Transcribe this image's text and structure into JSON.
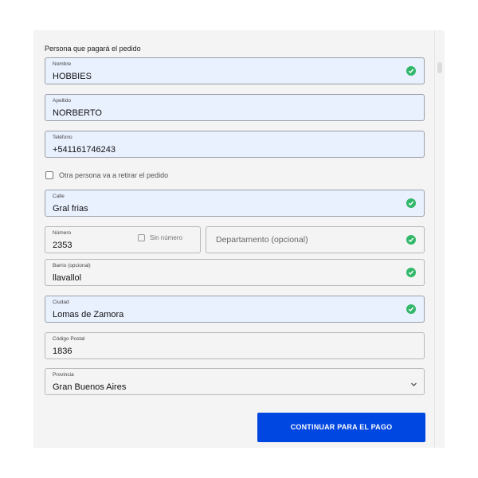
{
  "form": {
    "section_title": "Persona que pagará el pedido",
    "nombre": {
      "label": "Nombre",
      "value": "HOBBIES"
    },
    "apellido": {
      "label": "Apellido",
      "value": "NORBERTO"
    },
    "telefono": {
      "label": "Teléfono",
      "value": "+541161746243"
    },
    "otra_persona_label": "Otra persona va a retirar el pedido",
    "calle": {
      "label": "Calle",
      "value": "Gral frias"
    },
    "numero": {
      "label": "Número",
      "value": "2353"
    },
    "sin_numero_label": "Sin número",
    "departamento": {
      "placeholder": "Departamento (opcional)"
    },
    "barrio": {
      "label": "Barrio (opcional)",
      "value": "llavallol"
    },
    "ciudad": {
      "label": "Ciudad",
      "value": "Lomas de Zamora"
    },
    "codigo_postal": {
      "label": "Código Postal",
      "value": "1836"
    },
    "provincia": {
      "label": "Provincia",
      "value": "Gran Buenos Aires"
    },
    "submit_label": "CONTINUAR PARA EL PAGO"
  },
  "colors": {
    "accent": "#0046e0",
    "valid": "#33b86b",
    "filled_bg": "#e9f0fe",
    "panel_bg": "#f4f4f4"
  },
  "icons": {
    "valid": "check-circle-icon",
    "select": "chevron-down-icon"
  }
}
